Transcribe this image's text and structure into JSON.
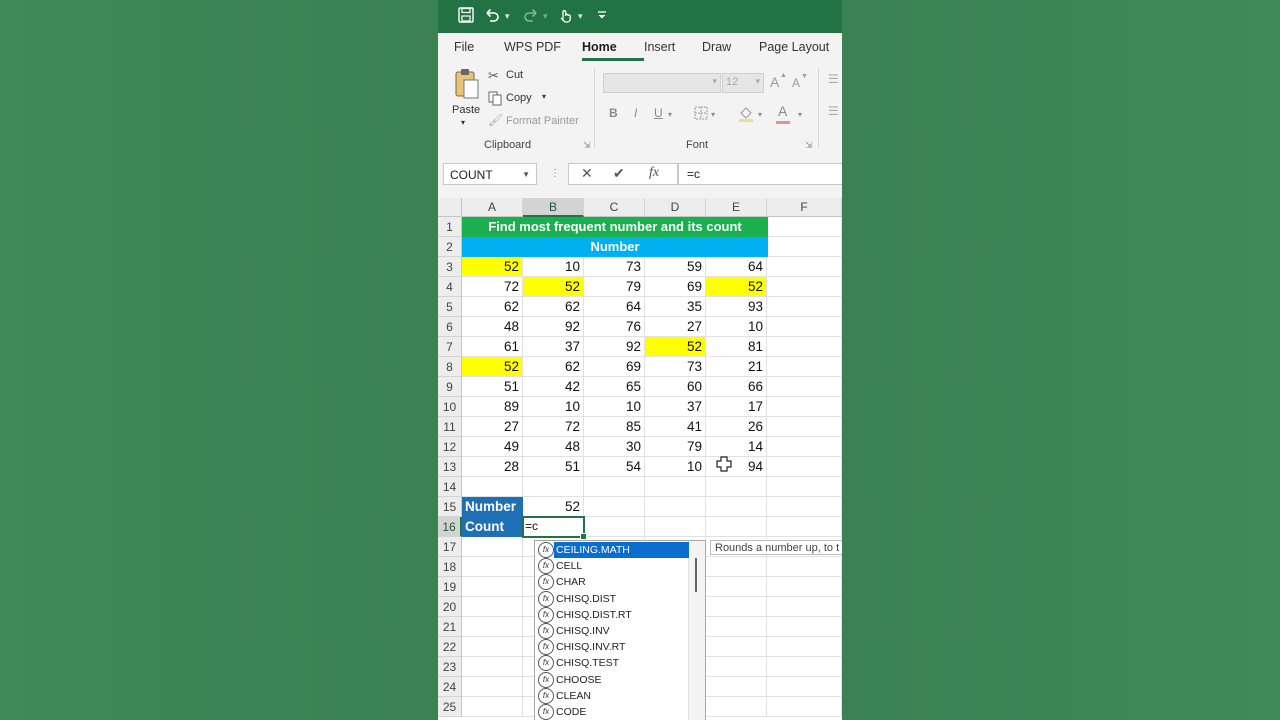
{
  "window": {
    "accent": "#217346"
  },
  "quick_access": {
    "icons": [
      "save-icon",
      "undo-icon",
      "redo-icon",
      "touch-mode-icon",
      "customize-qat-icon"
    ]
  },
  "tabs": [
    {
      "label": "File"
    },
    {
      "label": "WPS PDF"
    },
    {
      "label": "Home",
      "active": true
    },
    {
      "label": "Insert"
    },
    {
      "label": "Draw"
    },
    {
      "label": "Page Layout"
    }
  ],
  "ribbon": {
    "clipboard": {
      "paste": "Paste",
      "cut": "Cut",
      "copy": "Copy",
      "format_painter": "Format Painter",
      "group": "Clipboard"
    },
    "font": {
      "family": "",
      "size": "12",
      "bold": "B",
      "italic": "I",
      "underline": "U",
      "grow": "A",
      "shrink": "A",
      "font_color": "A",
      "group": "Font"
    }
  },
  "formula_bar": {
    "name_box": "COUNT",
    "formula": "=c",
    "cancel": "✕",
    "enter": "✔",
    "fx": "fx"
  },
  "sheet": {
    "columns": [
      "A",
      "B",
      "C",
      "D",
      "E",
      "F"
    ],
    "selected_column": "B",
    "rows": [
      "1",
      "2",
      "3",
      "4",
      "5",
      "6",
      "7",
      "8",
      "9",
      "10",
      "11",
      "12",
      "13",
      "14",
      "15",
      "16",
      "17",
      "18",
      "19",
      "20",
      "21",
      "22",
      "23",
      "24",
      "25"
    ],
    "selected_row": "16",
    "banner_title": "Find most frequent number and its count",
    "banner_subtitle": "Number",
    "banner_title_color": "#1ab04f",
    "banner_subtitle_color": "#00b0f0",
    "data": [
      [
        "52",
        "10",
        "73",
        "59",
        "64"
      ],
      [
        "72",
        "52",
        "79",
        "69",
        "52"
      ],
      [
        "62",
        "62",
        "64",
        "35",
        "93"
      ],
      [
        "48",
        "92",
        "76",
        "27",
        "10"
      ],
      [
        "61",
        "37",
        "92",
        "52",
        "81"
      ],
      [
        "52",
        "62",
        "69",
        "73",
        "21"
      ],
      [
        "51",
        "42",
        "65",
        "60",
        "66"
      ],
      [
        "89",
        "10",
        "10",
        "37",
        "17"
      ],
      [
        "27",
        "72",
        "85",
        "41",
        "26"
      ],
      [
        "49",
        "48",
        "30",
        "79",
        "14"
      ],
      [
        "28",
        "51",
        "54",
        "10",
        "94"
      ]
    ],
    "highlight_color": "#ffff00",
    "highlighted_cells": [
      "A3",
      "B4",
      "E4",
      "D7",
      "A8"
    ],
    "label_number": "Number",
    "value_number": "52",
    "label_count": "Count",
    "editing_value": "=c"
  },
  "autocomplete": {
    "items": [
      "CEILING.MATH",
      "CELL",
      "CHAR",
      "CHISQ.DIST",
      "CHISQ.DIST.RT",
      "CHISQ.INV",
      "CHISQ.INV.RT",
      "CHISQ.TEST",
      "CHOOSE",
      "CLEAN",
      "CODE"
    ],
    "selected": "CEILING.MATH",
    "icon_text": "fx",
    "tooltip": "Rounds a number up, to t"
  }
}
